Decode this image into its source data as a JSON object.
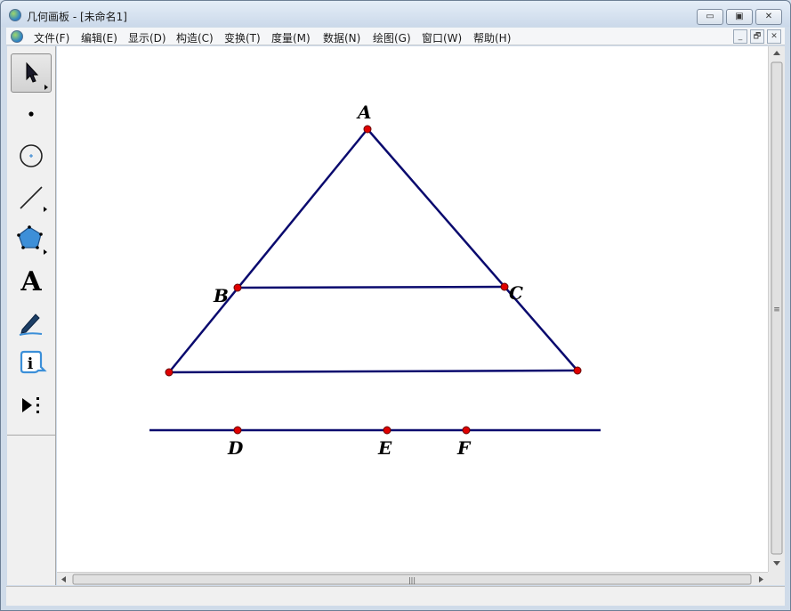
{
  "window": {
    "title": "几何画板 - [未命名1]",
    "controls": {
      "minimize": "▭",
      "maximize": "▣",
      "close": "✕"
    }
  },
  "menu": {
    "items": [
      "文件(F)",
      "编辑(E)",
      "显示(D)",
      "构造(C)",
      "变换(T)",
      "度量(M)",
      "数据(N)",
      "绘图(G)",
      "窗口(W)",
      "帮助(H)"
    ],
    "doc_controls": {
      "minimize": "_",
      "restore": "🗗",
      "close": "✕"
    }
  },
  "toolbox": {
    "tools": [
      "arrow-select-icon",
      "point-icon",
      "compass-icon",
      "straightedge-icon",
      "polygon-icon",
      "text-tool-icon",
      "marker-icon",
      "information-icon",
      "custom-tools-icon"
    ],
    "text_tool_glyph": "A",
    "info_glyph": "i"
  },
  "canvas": {
    "points": [
      {
        "label": "A"
      },
      {
        "label": "B"
      },
      {
        "label": "C"
      },
      {
        "label": "D"
      },
      {
        "label": "E"
      },
      {
        "label": "F"
      }
    ],
    "line_color": "#0a0a6e",
    "point_color": "#e00000"
  },
  "scrollbars": {
    "grip": "≡",
    "hgrip": "|||"
  }
}
